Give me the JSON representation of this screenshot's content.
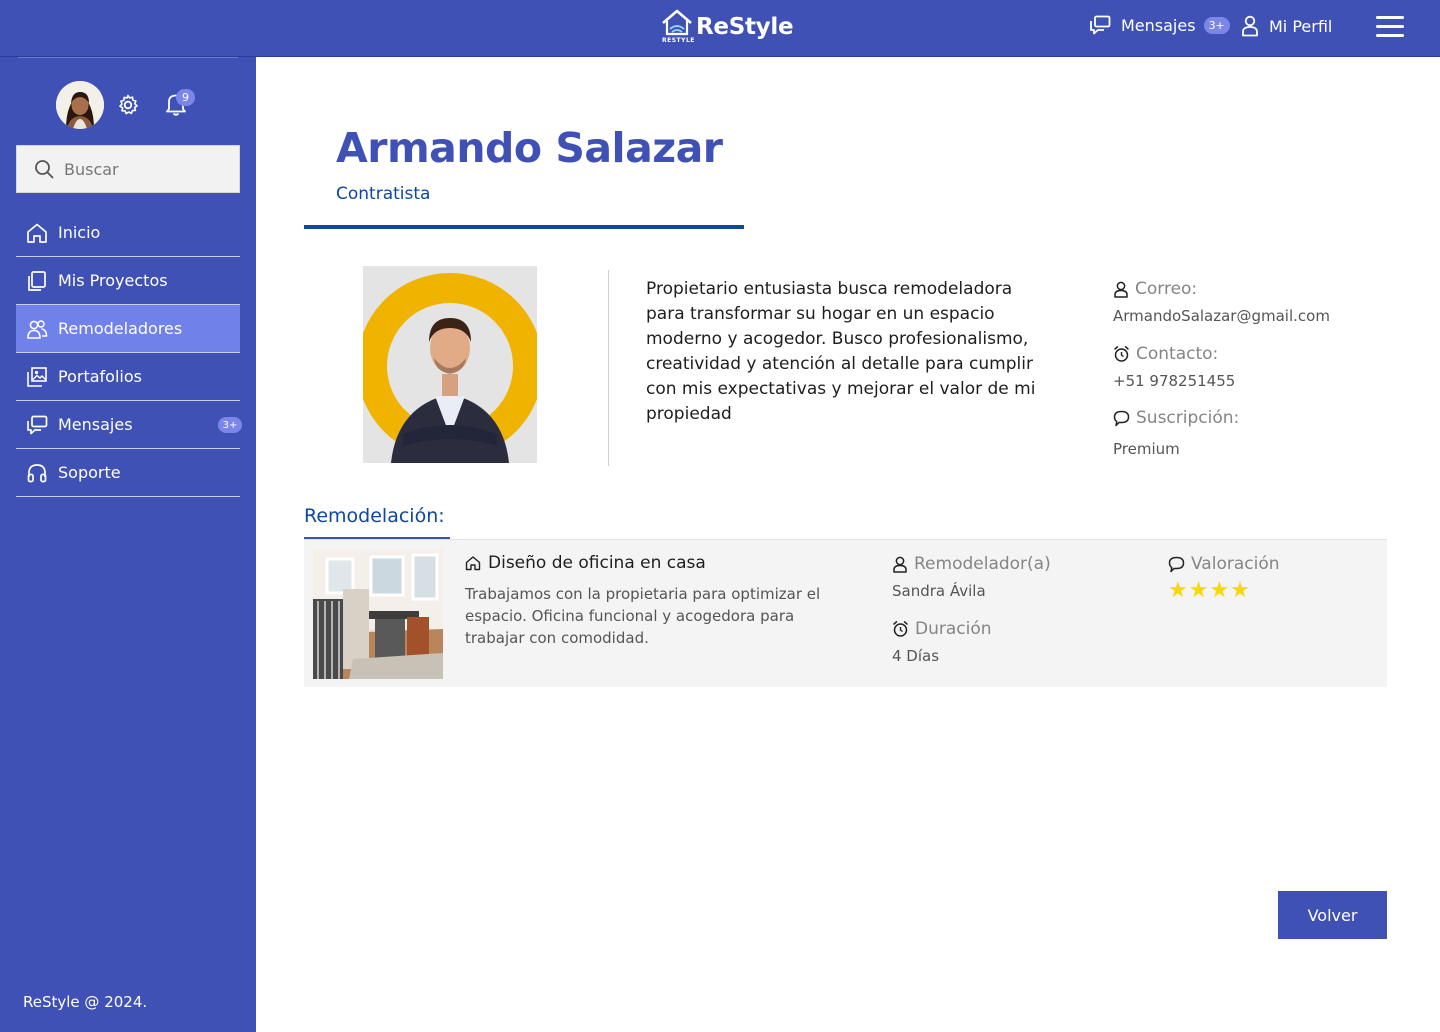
{
  "header": {
    "logo_text": "ReStyle",
    "logo_sub": "RESTYLE",
    "messages_label": "Mensajes",
    "messages_badge": "3+",
    "profile_label": "Mi Perfil"
  },
  "sidebar": {
    "notifications_count": "9",
    "search_placeholder": "Buscar",
    "items": [
      {
        "label": "Inicio",
        "icon": "home-icon"
      },
      {
        "label": "Mis Proyectos",
        "icon": "projects-icon"
      },
      {
        "label": "Remodeladores",
        "icon": "users-icon",
        "active": true
      },
      {
        "label": "Portafolios",
        "icon": "portfolio-icon"
      },
      {
        "label": "Mensajes",
        "icon": "messages-icon",
        "badge": "3+"
      },
      {
        "label": "Soporte",
        "icon": "headset-icon"
      }
    ],
    "footer": "ReStyle @ 2024."
  },
  "profile": {
    "name": "Armando Salazar",
    "role": "Contratista",
    "bio": "Propietario entusiasta busca remodeladora para transformar su hogar en un espacio moderno y acogedor. Busco profesionalismo, creatividad y atención al detalle para cumplir con mis expectativas y mejorar el valor de mi propiedad",
    "email_label": "Correo:",
    "email": "ArmandoSalazar@gmail.com",
    "contact_label": "Contacto:",
    "contact": "+51 978251455",
    "subscription_label": "Suscripción:",
    "subscription": "Premium"
  },
  "remodel": {
    "section_title": "Remodelación:",
    "title": "Diseño de oficina en casa",
    "description": "Trabajamos con la propietaria para optimizar el espacio. Oficina funcional y acogedora para trabajar con comodidad.",
    "remodeler_label": "Remodelador(a)",
    "remodeler": "Sandra Ávila",
    "duration_label": "Duración",
    "duration": "4 Días",
    "rating_label": "Valoración",
    "rating": 4,
    "rating_stars": "★★★★"
  },
  "actions": {
    "back_label": "Volver"
  },
  "colors": {
    "primary": "#3f51b5",
    "accent_dark": "#0d47a1",
    "active_nav": "#7181ea",
    "badge": "#7c86e8",
    "star": "#f5d90a"
  }
}
